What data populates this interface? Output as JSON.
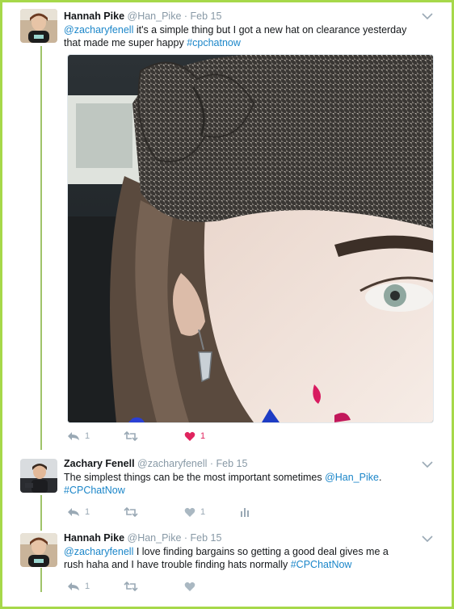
{
  "tweets": [
    {
      "name": "Hannah Pike",
      "handle": "@Han_Pike",
      "sep": "·",
      "date": "Feb 15",
      "text_parts": [
        {
          "t": "@zacharyfenell",
          "cls": "mention"
        },
        {
          "t": " it's a simple thing but I got a new hat on clearance yesterday that made me super happy ",
          "cls": ""
        },
        {
          "t": "#cpchatnow",
          "cls": "hash"
        }
      ],
      "reply_count": "1",
      "retweet_count": "",
      "like_count": "1",
      "liked": true
    },
    {
      "name": "Zachary Fenell",
      "handle": "@zacharyfenell",
      "sep": "·",
      "date": "Feb 15",
      "text_parts": [
        {
          "t": "The simplest things can be the most important sometimes ",
          "cls": ""
        },
        {
          "t": "@Han_Pike",
          "cls": "mention"
        },
        {
          "t": ".",
          "cls": ""
        },
        {
          "t": "#CPChatNow",
          "cls": "hash"
        }
      ],
      "reply_count": "1",
      "retweet_count": "",
      "like_count": "1",
      "liked": false
    },
    {
      "name": "Hannah Pike",
      "handle": "@Han_Pike",
      "sep": "·",
      "date": "Feb 15",
      "text_parts": [
        {
          "t": "@zacharyfenell",
          "cls": "mention"
        },
        {
          "t": " I love finding bargains so getting a good deal gives me a rush haha and I have trouble finding hats normally ",
          "cls": ""
        },
        {
          "t": "#CPChatNow",
          "cls": "hash"
        }
      ],
      "reply_count": "1",
      "retweet_count": "",
      "like_count": "",
      "liked": false
    }
  ],
  "icons": {
    "reply": "reply-icon",
    "retweet": "retweet-icon",
    "like": "heart-icon",
    "analytics": "analytics-icon",
    "more": "chevron-down-icon"
  },
  "colors": {
    "frame_border": "#a6d84a",
    "link": "#1b86c9",
    "like_active": "#e0245e",
    "thread_line": "#9fc36a",
    "muted": "#8899a6"
  }
}
